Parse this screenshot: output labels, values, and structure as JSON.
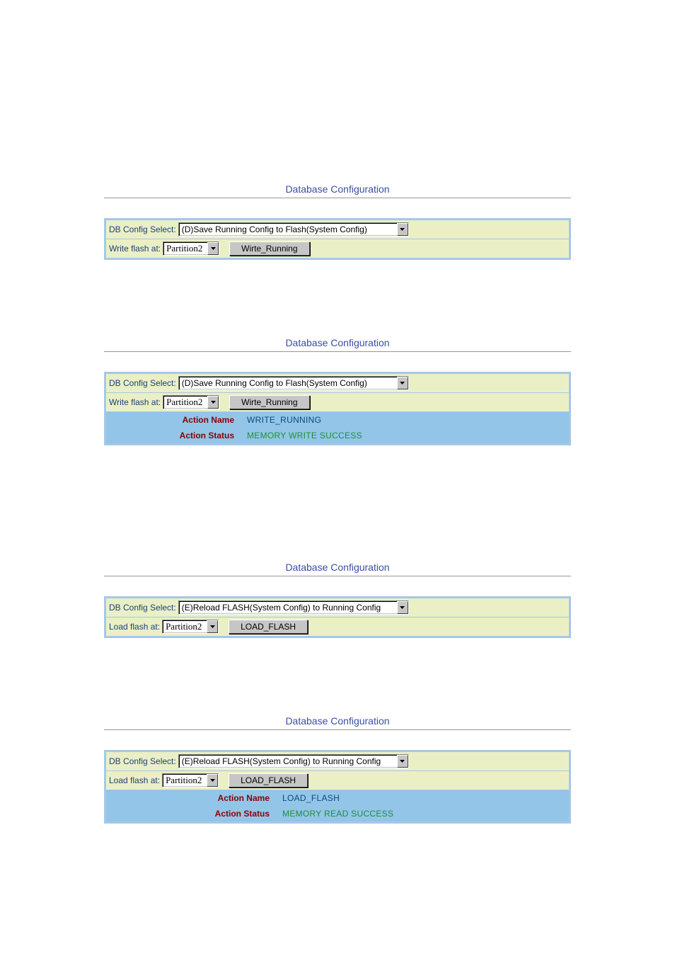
{
  "title": "Database Configuration",
  "labels": {
    "db_config_select": "DB Config Select:",
    "write_flash_at": "Write flash at:",
    "load_flash_at": "Load flash at:"
  },
  "options": {
    "save_running": "(D)Save Running Config to Flash(System Config)",
    "reload_flash": "(E)Reload FLASH(System Config) to Running Config",
    "partition": "Partition2"
  },
  "buttons": {
    "write_running": "Wirte_Running",
    "load_flash": "LOAD_FLASH"
  },
  "status_labels": {
    "action_name": "Action Name",
    "action_status": "Action Status"
  },
  "status": {
    "write_action_name": "WRITE_RUNNING",
    "write_action_status": "MEMORY WRITE SUCCESS",
    "load_action_name": "LOAD_FLASH",
    "load_action_status": "MEMORY READ SUCCESS"
  }
}
